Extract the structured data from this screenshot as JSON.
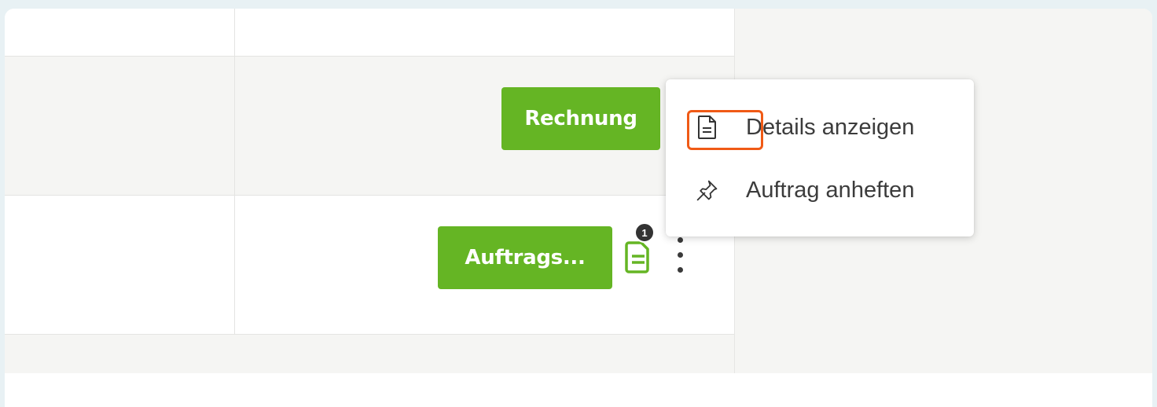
{
  "table": {
    "rows": [
      {
        "action_label": "Rechnung"
      },
      {
        "action_label": "Auftrags...",
        "document_badge_count": "1"
      }
    ]
  },
  "context_menu": {
    "items": [
      {
        "label": "Details anzeigen",
        "icon": "document-icon"
      },
      {
        "label": "Auftrag anheften",
        "icon": "pin-icon"
      }
    ]
  },
  "colors": {
    "accent_green": "#65b524",
    "highlight_orange": "#f05a16"
  }
}
